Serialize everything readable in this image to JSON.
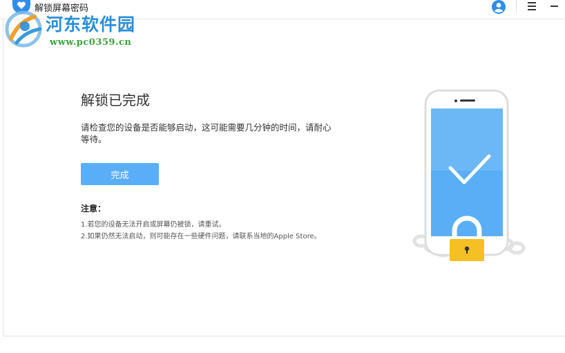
{
  "titlebar": {
    "app_title": "解锁屏幕密码",
    "icons": [
      "app-heart-icon",
      "user-account-icon",
      "menu-icon",
      "minimize-icon"
    ]
  },
  "watermark": {
    "name": "河东软件园",
    "url": "www.pc0359.cn"
  },
  "main": {
    "heading": "解锁已完成",
    "description": "请检查您的设备是否能够启动，这可能需要几分钟的时间，请耐心等待。",
    "done_button": "完成",
    "note_title": "注意：",
    "notes": [
      "1.若您的设备无法开启或屏幕仍被锁，请重试。",
      "2.如果仍然无法启动，则可能存在一些硬件问题，请联系当地的Apple Store。"
    ]
  },
  "colors": {
    "accent": "#5aaef7",
    "app_icon": "#2f8ee8",
    "lock": "#f5c023",
    "screen": "#5aaef5"
  }
}
